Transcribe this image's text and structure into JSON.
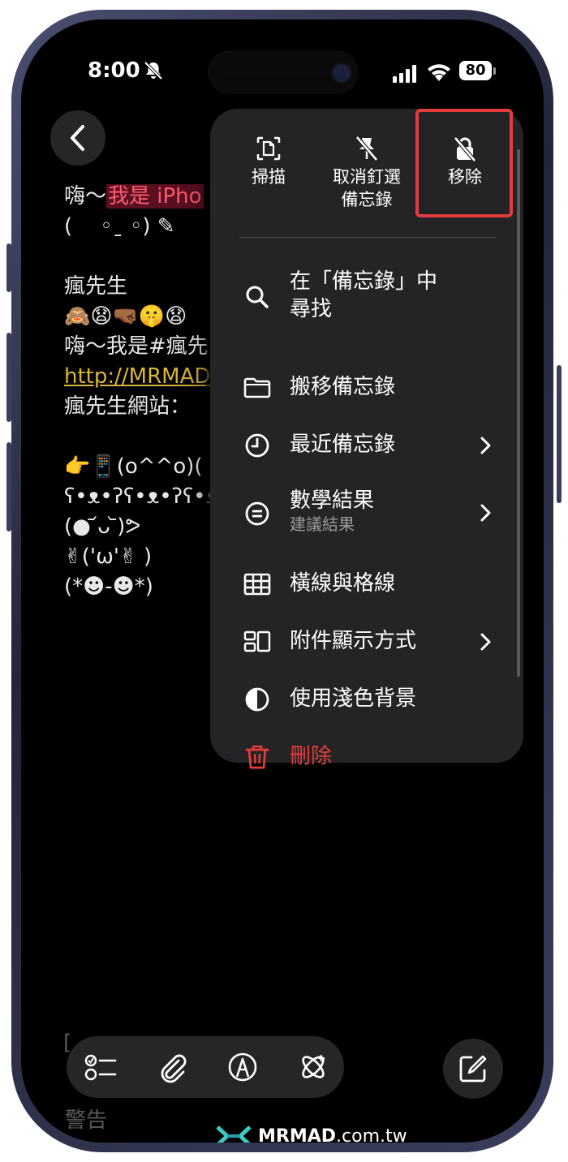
{
  "status_bar": {
    "time": "8:00",
    "battery": "80"
  },
  "note_lines": [
    {
      "pre": "嗨～",
      "hl": "我是 iPho",
      "post": ""
    },
    {
      "pre": "(　 ◦ˍ ◦) ✎",
      "hl": "",
      "post": ""
    },
    {
      "pre": "",
      "hl": "",
      "post": ""
    },
    {
      "pre": "瘋先生",
      "hl": "",
      "post": ""
    },
    {
      "pre": "🙈😧🤜🏾🤫😧",
      "hl": "",
      "post": ""
    },
    {
      "pre": "嗨～我是#瘋先",
      "hl": "",
      "post": ""
    },
    {
      "pre": "",
      "hl": "",
      "post": "",
      "link": "http://MRMAD"
    },
    {
      "pre": "瘋先生網站：",
      "hl": "",
      "post": ""
    },
    {
      "pre": "",
      "hl": "",
      "post": ""
    },
    {
      "pre": "👉📱(o^^o)(",
      "hl": "",
      "post": ""
    },
    {
      "pre": "ʕ•ᴥ•ʔʕ•ᴥ•ʔʕ•ᴥ•ʔ",
      "hl": "",
      "post": ""
    },
    {
      "pre": "(● ᷄ᴗ ᷅)ᕗ",
      "hl": "",
      "post": ""
    },
    {
      "pre": "✌('ω'✌ )",
      "hl": "",
      "post": ""
    },
    {
      "pre": "(*☻-☻*)",
      "hl": "",
      "post": ""
    }
  ],
  "menu": {
    "quick_actions": [
      {
        "label": "掃描"
      },
      {
        "label": "取消釘選\n備忘錄"
      },
      {
        "label": "移除"
      }
    ],
    "items": [
      {
        "label": "在「備忘錄」中\n尋找",
        "icon": "search-icon",
        "chevron": false
      },
      {
        "label": "搬移備忘錄",
        "icon": "folder-icon",
        "chevron": false
      },
      {
        "label": "最近備忘錄",
        "icon": "clock-icon",
        "chevron": true
      },
      {
        "label": "數學結果",
        "sub": "建議結果",
        "icon": "equals-circle-icon",
        "chevron": true
      },
      {
        "label": "橫線與格線",
        "icon": "grid-icon",
        "chevron": false
      },
      {
        "label": "附件顯示方式",
        "icon": "attachment-view-icon",
        "chevron": true
      },
      {
        "label": "使用淺色背景",
        "icon": "contrast-icon",
        "chevron": false
      },
      {
        "label": "刪除",
        "icon": "trash-icon",
        "chevron": false,
        "destructive": true
      }
    ]
  },
  "bottom": {
    "left_text": "[",
    "warning": "警告"
  },
  "watermark": {
    "brand": "MRMAD",
    "domain": ".com.tw"
  },
  "colors": {
    "accent_red": "#e33c3c",
    "link": "#d9b53a",
    "pink": "#ff5a72"
  }
}
